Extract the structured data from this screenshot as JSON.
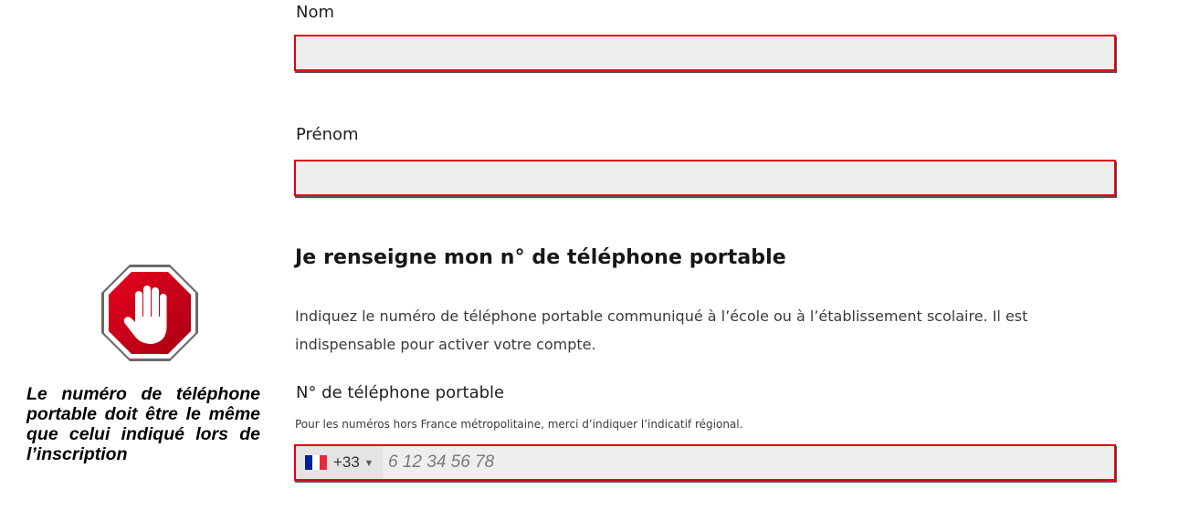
{
  "form": {
    "nom_label": "Nom",
    "nom_value": "",
    "prenom_label": "Prénom",
    "prenom_value": "",
    "phone_section": {
      "title": "Je renseigne mon n° de téléphone portable",
      "description": "Indiquez le numéro de téléphone portable communiqué à l’école ou à l’établissement scolaire. Il est indispensable pour activer votre compte.",
      "field_label": "N° de téléphone portable",
      "hint": "Pour les numéros hors France métropolitaine, merci d’indiquer l’indicatif régional.",
      "country_code": "+33",
      "country_flag": "france-flag-icon",
      "placeholder": "6 12 34 56 78",
      "value": ""
    }
  },
  "annotation": {
    "icon": "stop-hand-icon",
    "note": "Le numéro de téléphone portable doit être le même que celui indiqué lors de l’inscription"
  },
  "colors": {
    "error_border": "#e1000f",
    "field_bg": "#eeeeee",
    "stop_red": "#d6001c",
    "flag_blue": "#002395",
    "flag_red": "#ed2939"
  }
}
